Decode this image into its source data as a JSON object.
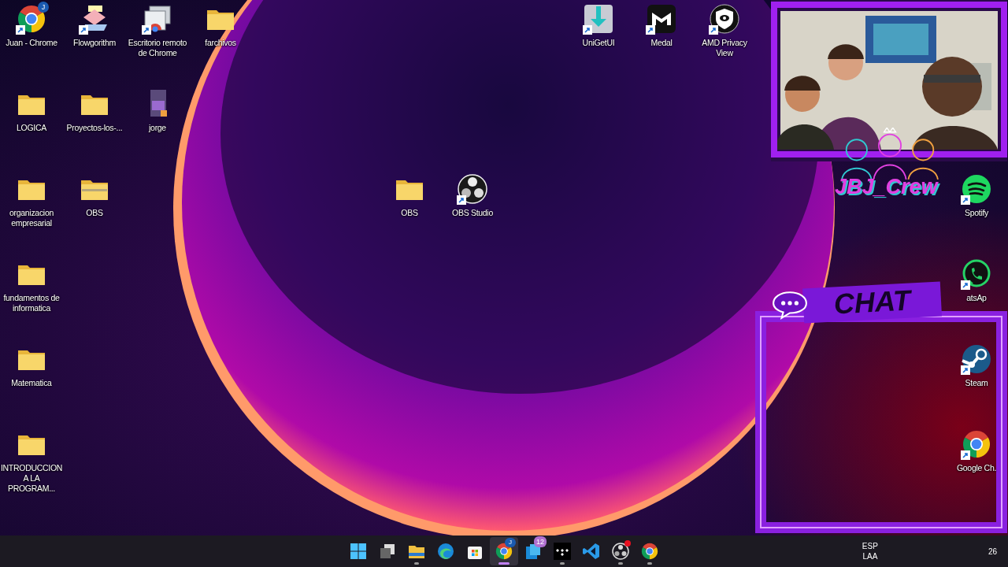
{
  "desktop": {
    "icons": [
      {
        "label": "Juan - Chrome",
        "kind": "chrome",
        "shortcut": true,
        "badge": "J"
      },
      {
        "label": "Flowgorithm",
        "kind": "flowgorithm",
        "shortcut": true
      },
      {
        "label": "Escritorio remoto de Chrome",
        "kind": "remote",
        "shortcut": true
      },
      {
        "label": "farchivos",
        "kind": "folder",
        "shortcut": false
      },
      {
        "label": "UniGetUI",
        "kind": "unigetui",
        "shortcut": true
      },
      {
        "label": "Medal",
        "kind": "medal",
        "shortcut": true
      },
      {
        "label": "AMD Privacy View",
        "kind": "amd",
        "shortcut": true
      },
      {
        "label": "LOGICA",
        "kind": "folder",
        "shortcut": false
      },
      {
        "label": "Proyectos-los-...",
        "kind": "folder",
        "shortcut": false
      },
      {
        "label": "jorge",
        "kind": "video",
        "shortcut": false
      },
      {
        "label": "organizacion empresarial",
        "kind": "folder",
        "shortcut": false
      },
      {
        "label": "OBS",
        "kind": "zip-folder",
        "shortcut": false
      },
      {
        "label": "OBS",
        "kind": "folder",
        "shortcut": false
      },
      {
        "label": "OBS Studio",
        "kind": "obs",
        "shortcut": true
      },
      {
        "label": "Spotify",
        "kind": "spotify",
        "shortcut": true
      },
      {
        "label": "fundamentos de informatica",
        "kind": "folder",
        "shortcut": false
      },
      {
        "label": "atsAp",
        "kind": "whatsapp",
        "shortcut": true
      },
      {
        "label": "Matematica",
        "kind": "folder",
        "shortcut": false
      },
      {
        "label": "Steam",
        "kind": "steam",
        "shortcut": true
      },
      {
        "label": "INTRODUCCION A LA PROGRAM...",
        "kind": "folder",
        "shortcut": false
      },
      {
        "label": "Google Ch.",
        "kind": "chrome",
        "shortcut": true
      }
    ]
  },
  "overlay": {
    "crew_name": "JBJ_Crew",
    "chat_title": "CHAT"
  },
  "taskbar": {
    "items": [
      {
        "kind": "start",
        "active": false,
        "running": false,
        "alert": false
      },
      {
        "kind": "taskview",
        "active": false,
        "running": false,
        "alert": false
      },
      {
        "kind": "explorer",
        "active": false,
        "running": true,
        "alert": false
      },
      {
        "kind": "edge",
        "active": false,
        "running": false,
        "alert": false
      },
      {
        "kind": "store",
        "active": false,
        "running": false,
        "alert": false
      },
      {
        "kind": "chrome",
        "active": true,
        "running": true,
        "alert": false,
        "badge": "J"
      },
      {
        "kind": "app",
        "active": false,
        "running": false,
        "alert": false,
        "badge": "12"
      },
      {
        "kind": "tidal",
        "active": false,
        "running": true,
        "alert": false
      },
      {
        "kind": "vscode",
        "active": false,
        "running": false,
        "alert": false
      },
      {
        "kind": "obs",
        "active": false,
        "running": true,
        "alert": true
      },
      {
        "kind": "chrome",
        "active": false,
        "running": true,
        "alert": false
      }
    ],
    "language": "ESP",
    "layout": "LAA",
    "clock": "26"
  }
}
